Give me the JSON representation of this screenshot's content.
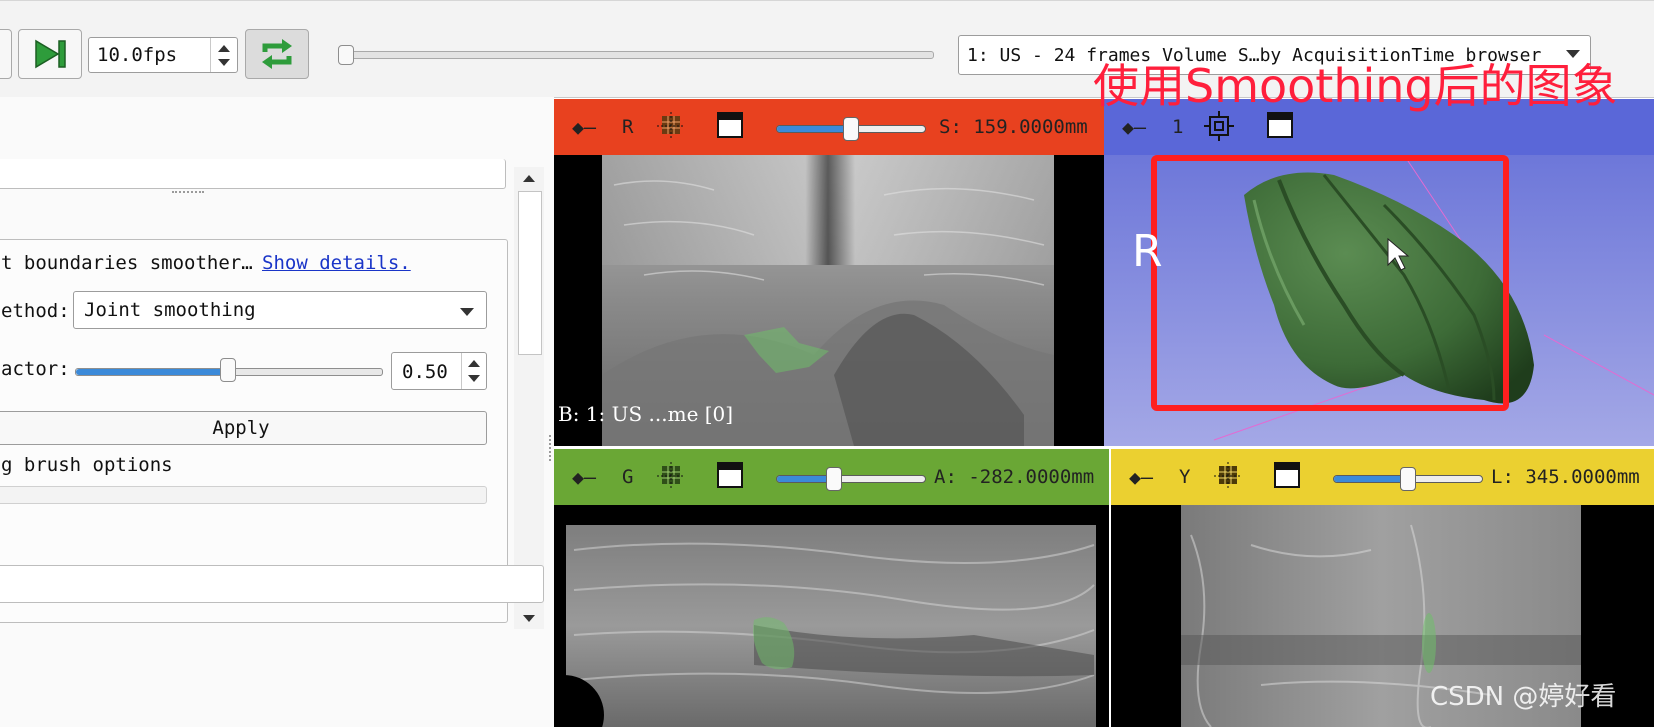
{
  "toolbar": {
    "fps_value": "10.0fps",
    "browser_selector": "1: US - 24 frames Volume S…by AcquisitionTime browser"
  },
  "left_panel": {
    "description": "t boundaries smoother…",
    "show_details_link": "Show details.",
    "method_label": "ethod:",
    "method_value": "Joint smoothing",
    "factor_label": "actor:",
    "factor_value": "0.50",
    "factor_level": 0.5,
    "apply_label": "Apply",
    "brush_options_label": "g brush options"
  },
  "views": {
    "red": {
      "label": "R",
      "offset": "S: 159.0000mm",
      "background_label": "B: 1: US ...me [0]",
      "slider_level": 0.5
    },
    "three_d": {
      "label": "1",
      "orientation_marker": "R"
    },
    "green": {
      "label": "G",
      "offset": "A: -282.0000mm",
      "slider_level": 0.37
    },
    "yellow": {
      "label": "Y",
      "offset": "L: 345.0000mm",
      "slider_level": 0.5
    }
  },
  "annotation": "使用Smoothing后的图象",
  "watermark": "CSDN @婷好看",
  "colors": {
    "red_bar": "#e8411f",
    "blue_bar": "#5a67d8",
    "green_bar": "#6aa735",
    "yellow_bar": "#ebd030",
    "annotation_red": "#ff1f3c",
    "accent_blue": "#3b8ad9"
  },
  "icons": [
    "play-next-frame-icon",
    "loop-icon",
    "pin-icon",
    "grid-icon",
    "window-icon",
    "center-view-icon",
    "chevron-down-icon",
    "mouse-cursor-icon"
  ]
}
